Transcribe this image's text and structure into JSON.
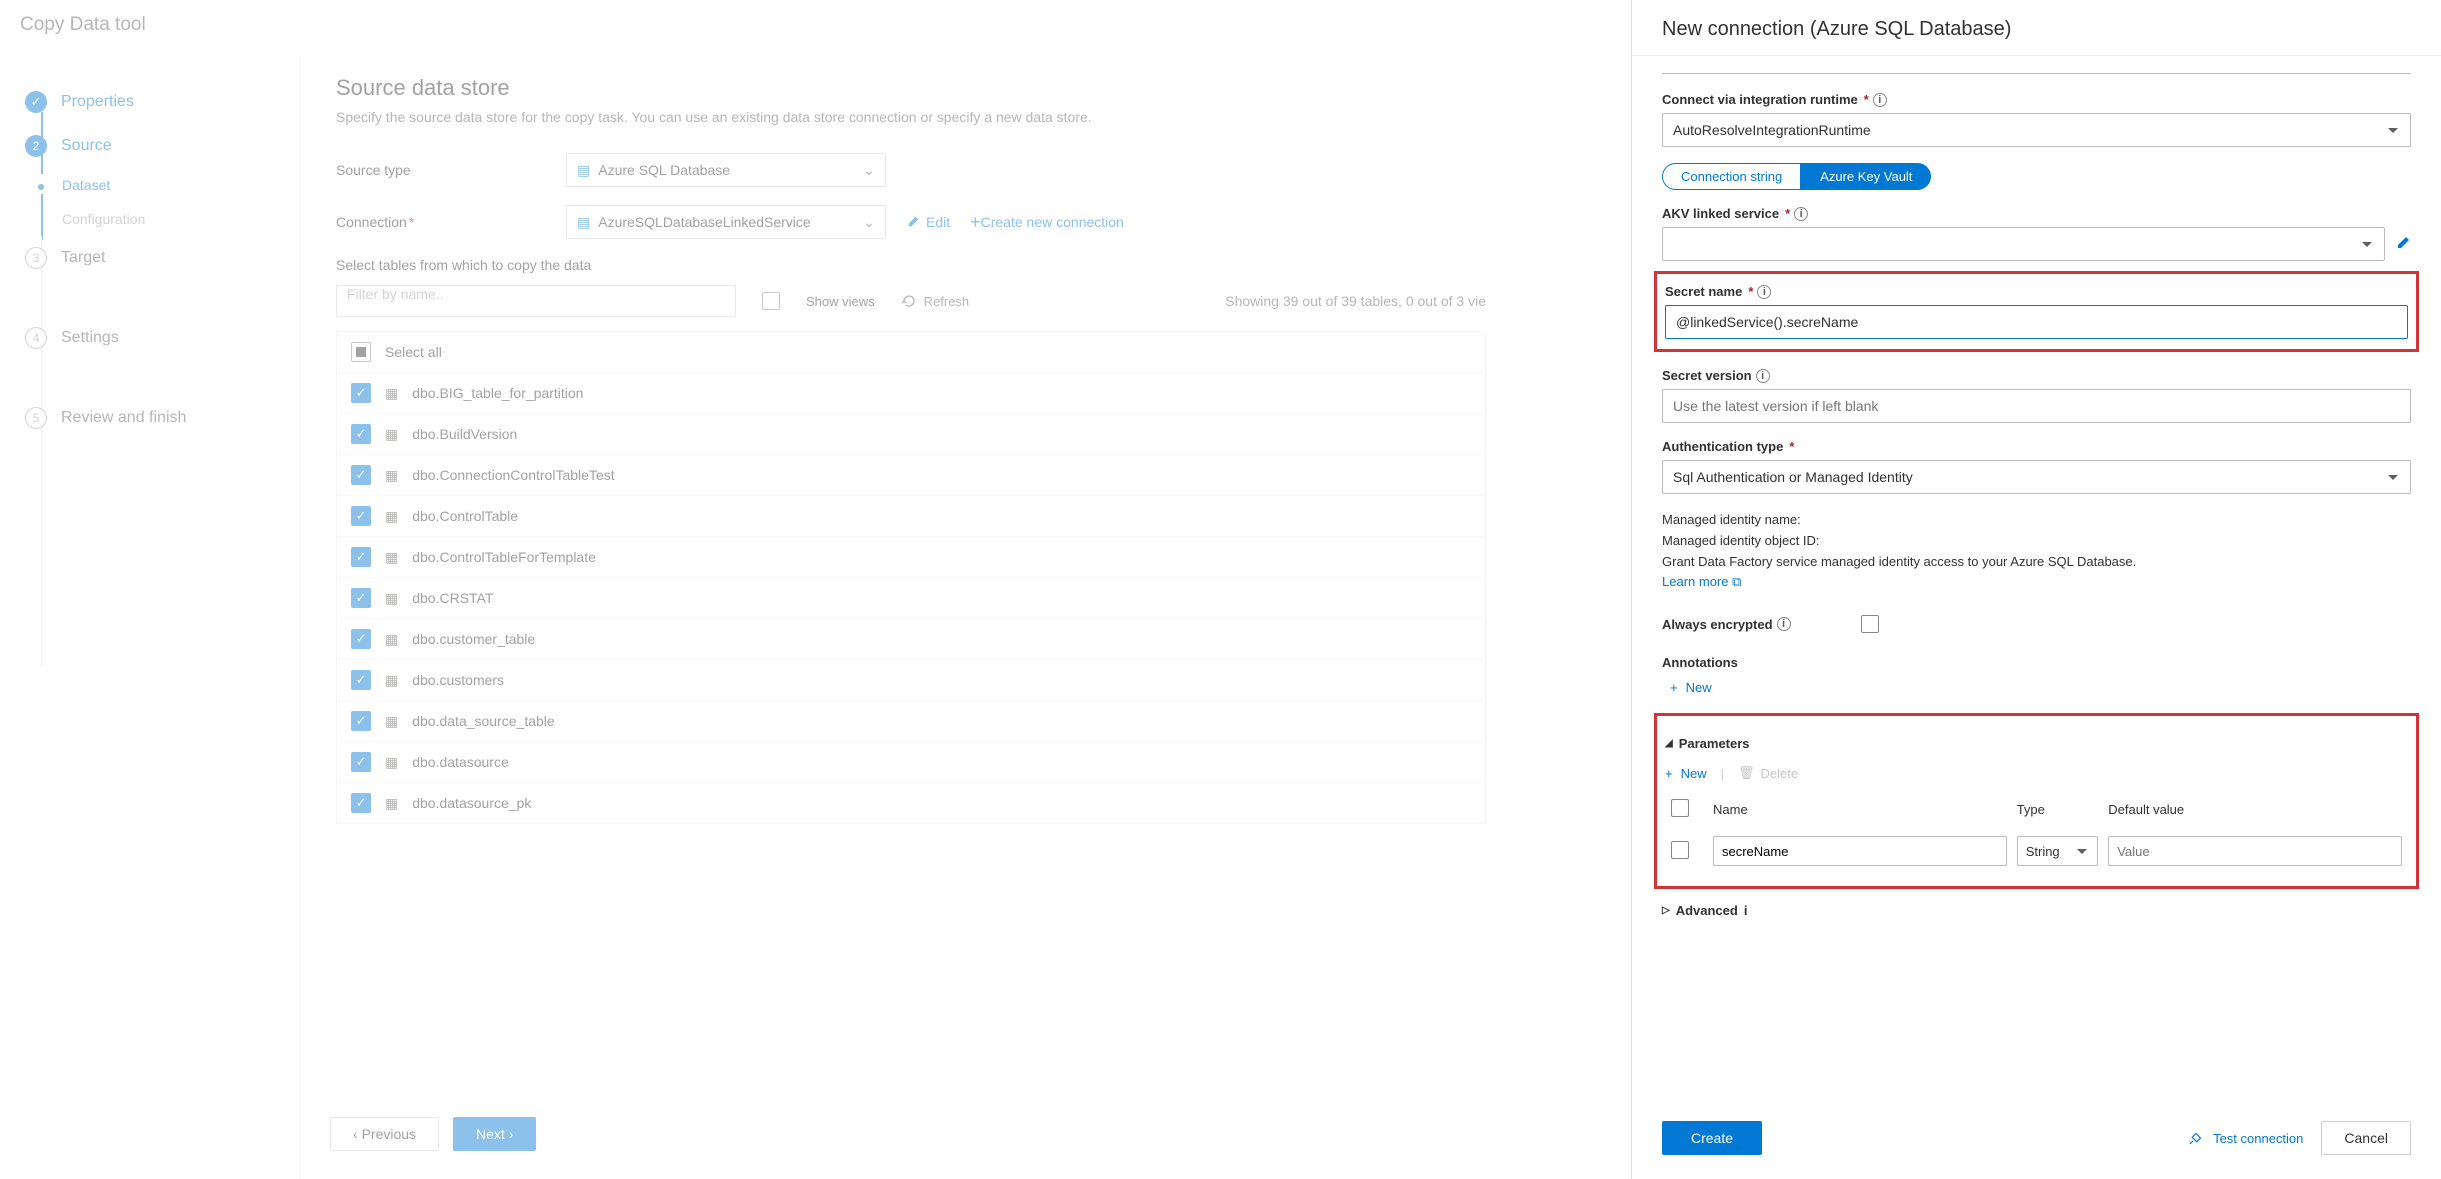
{
  "title": "Copy Data tool",
  "wizard": {
    "properties": "Properties",
    "source": "Source",
    "dataset": "Dataset",
    "configuration": "Configuration",
    "target": "Target",
    "settings": "Settings",
    "review": "Review and finish"
  },
  "main": {
    "heading": "Source data store",
    "subtitle": "Specify the source data store for the copy task. You can use an existing data store connection or specify a new data store.",
    "source_type_label": "Source type",
    "source_type_value": "Azure SQL Database",
    "connection_label": "Connection",
    "connection_value": "AzureSQLDatabaseLinkedService",
    "edit": "Edit",
    "create_new": "Create new connection",
    "select_tables_label": "Select tables from which to copy the data",
    "filter_placeholder": "Filter by name..",
    "show_views": "Show views",
    "refresh": "Refresh",
    "showing": "Showing 39 out of 39 tables, 0 out of 3 vie",
    "select_all": "Select all",
    "tables": [
      "dbo.BIG_table_for_partition",
      "dbo.BuildVersion",
      "dbo.ConnectionControlTableTest",
      "dbo.ControlTable",
      "dbo.ControlTableForTemplate",
      "dbo.CRSTAT",
      "dbo.customer_table",
      "dbo.customers",
      "dbo.data_source_table",
      "dbo.datasource",
      "dbo.datasource_pk"
    ],
    "previous": "Previous",
    "next": "Next"
  },
  "panel": {
    "title": "New connection (Azure SQL Database)",
    "runtime_label": "Connect via integration runtime",
    "runtime_value": "AutoResolveIntegrationRuntime",
    "pill_cs": "Connection string",
    "pill_akv": "Azure Key Vault",
    "akv_label": "AKV linked service",
    "secret_name_label": "Secret name",
    "secret_name_value": "@linkedService().secreName",
    "secret_version_label": "Secret version",
    "secret_version_placeholder": "Use the latest version if left blank",
    "auth_label": "Authentication type",
    "auth_value": "Sql Authentication or Managed Identity",
    "mi_name": "Managed identity name:",
    "mi_oid": "Managed identity object ID:",
    "grant": "Grant Data Factory service managed identity access to your Azure SQL Database.",
    "learn_more": "Learn more",
    "always_encrypted": "Always encrypted",
    "annotations": "Annotations",
    "new": "New",
    "parameters": "Parameters",
    "delete": "Delete",
    "col_name": "Name",
    "col_type": "Type",
    "col_default": "Default value",
    "param_name": "secreName",
    "param_type": "String",
    "param_default_placeholder": "Value",
    "advanced": "Advanced",
    "create": "Create",
    "test": "Test connection",
    "cancel": "Cancel"
  }
}
